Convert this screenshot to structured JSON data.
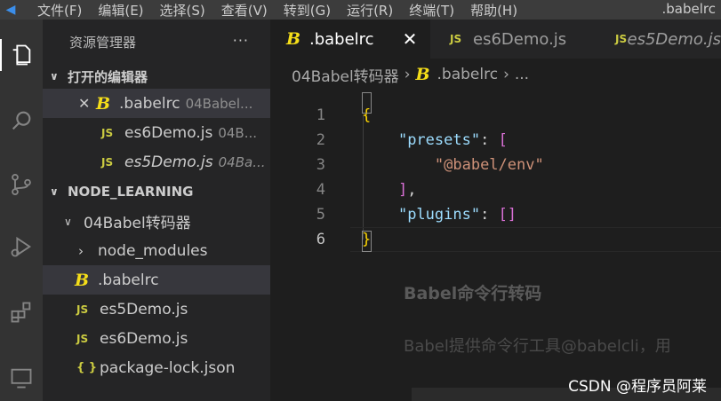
{
  "titlebar": {
    "menus": [
      "文件(F)",
      "编辑(E)",
      "选择(S)",
      "查看(V)",
      "转到(G)",
      "运行(R)",
      "终端(T)",
      "帮助(H)"
    ],
    "window_title": ".babelrc"
  },
  "sidebar": {
    "header": "资源管理器",
    "more": "···",
    "open_editors": {
      "title": "打开的编辑器",
      "items": [
        {
          "name": ".babelrc",
          "desc": "04Babel...",
          "icon": "babel-icon"
        },
        {
          "name": "es6Demo.js",
          "desc": "04B...",
          "icon": "js-icon"
        },
        {
          "name": "es5Demo.js",
          "desc": "04Ba...",
          "icon": "js-icon"
        }
      ]
    },
    "workspace": {
      "title": "NODE_LEARNING",
      "folder": "04Babel转码器",
      "items": [
        {
          "name": "node_modules",
          "type": "folder"
        },
        {
          "name": ".babelrc",
          "type": "babel"
        },
        {
          "name": "es5Demo.js",
          "type": "js"
        },
        {
          "name": "es6Demo.js",
          "type": "js"
        },
        {
          "name": "package-lock.json",
          "type": "json"
        }
      ]
    }
  },
  "tabs": [
    {
      "label": ".babelrc",
      "active": true,
      "close": "✕"
    },
    {
      "label": "es6Demo.js",
      "active": false
    },
    {
      "label": "es5Demo.js",
      "active": false
    }
  ],
  "breadcrumb": {
    "folder": "04Babel转码器",
    "file": ".babelrc",
    "more": "..."
  },
  "editor": {
    "lines": [
      {
        "n": "1",
        "tokens": [
          {
            "t": "{",
            "c": "brace"
          }
        ]
      },
      {
        "n": "2",
        "tokens": [
          {
            "t": "    ",
            "c": "punc"
          },
          {
            "t": "\"presets\"",
            "c": "key"
          },
          {
            "t": ": ",
            "c": "punc"
          },
          {
            "t": "[",
            "c": "bracket"
          }
        ]
      },
      {
        "n": "3",
        "tokens": [
          {
            "t": "        ",
            "c": "punc"
          },
          {
            "t": "\"@babel/env\"",
            "c": "str"
          }
        ]
      },
      {
        "n": "4",
        "tokens": [
          {
            "t": "    ",
            "c": "punc"
          },
          {
            "t": "]",
            "c": "bracket"
          },
          {
            "t": ",",
            "c": "punc"
          }
        ]
      },
      {
        "n": "5",
        "tokens": [
          {
            "t": "    ",
            "c": "punc"
          },
          {
            "t": "\"plugins\"",
            "c": "key"
          },
          {
            "t": ": ",
            "c": "punc"
          },
          {
            "t": "[]",
            "c": "bracket"
          }
        ]
      },
      {
        "n": "6",
        "tokens": [
          {
            "t": "}",
            "c": "brace"
          }
        ]
      }
    ],
    "current_line": "6"
  },
  "background_ghost": {
    "heading": "Babel命令行转码",
    "text": "Babel提供命令行工具@babelcli，用"
  },
  "watermark": "CSDN @程序员阿莱"
}
